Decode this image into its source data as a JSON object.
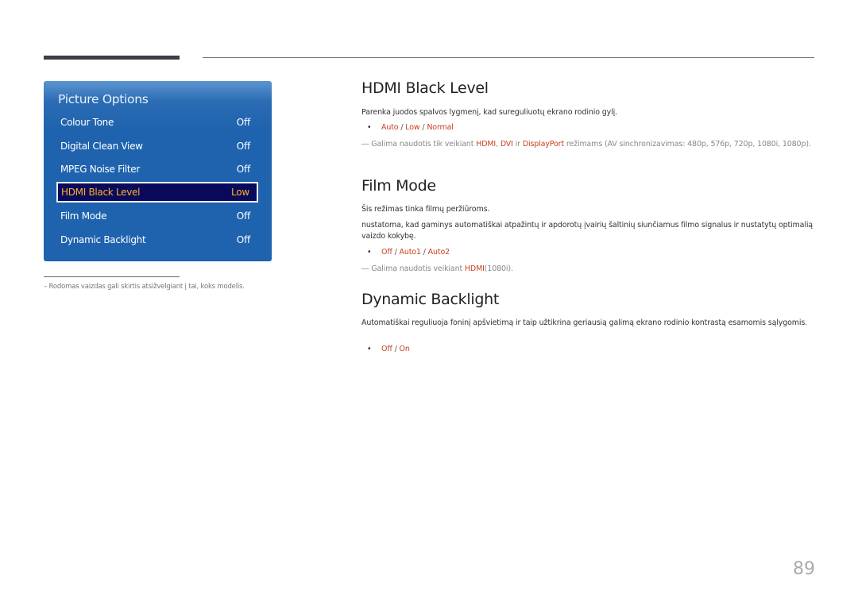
{
  "menu": {
    "title": "Picture Options",
    "items": [
      {
        "label": "Colour Tone",
        "value": "Off"
      },
      {
        "label": "Digital Clean View",
        "value": "Off"
      },
      {
        "label": "MPEG Noise Filter",
        "value": "Off"
      },
      {
        "label": "HDMI Black Level",
        "value": "Low",
        "selected": true
      },
      {
        "label": "Film Mode",
        "value": "Off"
      },
      {
        "label": "Dynamic Backlight",
        "value": "Off"
      }
    ]
  },
  "footnote": "–  Rodomas vaizdas gali skirtis atsižvelgiant į tai, koks modelis.",
  "colors": {
    "menu_bg": "#1f62ad",
    "selected_bg": "#0a0a5c",
    "selected_text": "#ffb027",
    "option_text": "#c8401f"
  },
  "sections": {
    "hdmi": {
      "title": "HDMI Black Level",
      "desc": "Parenka juodos spalvos lygmenį, kad sureguliuotų ekrano rodinio gylį.",
      "options": [
        "Auto",
        "Low",
        "Normal"
      ],
      "note_dash": "―",
      "note_pre": " Galima naudotis tik veikiant ",
      "note_hl1": "HDMI",
      "note_mid1": ", ",
      "note_hl2": "DVI",
      "note_mid2": " ir ",
      "note_hl3": "DisplayPort",
      "note_post": " režimams (AV sinchronizavimas: 480p, 576p, 720p, 1080i, 1080p)."
    },
    "film": {
      "title": "Film Mode",
      "desc1": "Šis režimas tinka filmų peržiūroms.",
      "desc2": "nustatoma, kad gaminys automatiškai atpažintų ir apdorotų įvairių šaltinių siunčiamus filmo signalus ir nustatytų optimalią vaizdo kokybę.",
      "options": [
        "Off",
        "Auto1",
        "Auto2"
      ],
      "note_dash": "―",
      "note_pre": " Galima naudotis veikiant ",
      "note_hl1": "HDMI",
      "note_post": "(1080i)."
    },
    "backlight": {
      "title": "Dynamic Backlight",
      "desc": "Automatiškai reguliuoja foninį apšvietimą ir taip užtikrina geriausią galimą ekrano rodinio kontrastą esamomis sąlygomis.",
      "options": [
        "Off",
        "On"
      ]
    }
  },
  "bullet": "•",
  "separator": " / ",
  "page_number": "89"
}
